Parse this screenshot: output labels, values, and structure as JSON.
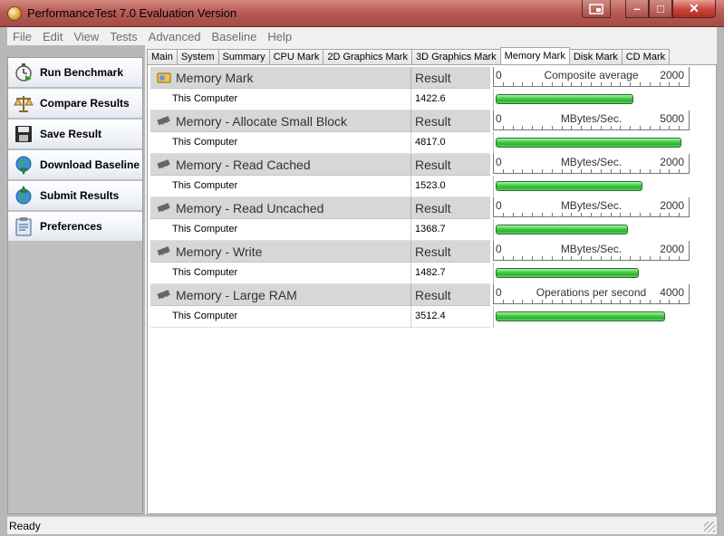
{
  "window": {
    "title": "PerformanceTest 7.0 Evaluation Version"
  },
  "caption_buttons": {
    "minimize": "–",
    "maximize": "□",
    "close": "✕"
  },
  "menu": [
    "File",
    "Edit",
    "View",
    "Tests",
    "Advanced",
    "Baseline",
    "Help"
  ],
  "sidebar": {
    "items": [
      {
        "label": "Run Benchmark",
        "icon": "stopwatch-icon"
      },
      {
        "label": "Compare Results",
        "icon": "scales-icon"
      },
      {
        "label": "Save Result",
        "icon": "floppy-disk-icon"
      },
      {
        "label": "Download Baseline",
        "icon": "globe-download-icon"
      },
      {
        "label": "Submit Results",
        "icon": "globe-upload-icon"
      },
      {
        "label": "Preferences",
        "icon": "clipboard-icon"
      }
    ]
  },
  "tabs": [
    {
      "label": "Main",
      "active": false
    },
    {
      "label": "System",
      "active": false
    },
    {
      "label": "Summary",
      "active": false
    },
    {
      "label": "CPU Mark",
      "active": false
    },
    {
      "label": "2D Graphics Mark",
      "active": false
    },
    {
      "label": "3D Graphics Mark",
      "active": false
    },
    {
      "label": "Memory Mark",
      "active": true
    },
    {
      "label": "Disk Mark",
      "active": false
    },
    {
      "label": "CD Mark",
      "active": false
    }
  ],
  "result_header": "Result",
  "sections": [
    {
      "title": "Memory Mark",
      "row_name": "This Computer",
      "value": "1422.6",
      "scale_min": "0",
      "scale_unit": "Composite average",
      "scale_max": "2000",
      "fraction": 0.7113
    },
    {
      "title": "Memory - Allocate Small Block",
      "row_name": "This Computer",
      "value": "4817.0",
      "scale_min": "0",
      "scale_unit": "MBytes/Sec.",
      "scale_max": "5000",
      "fraction": 0.9634
    },
    {
      "title": "Memory - Read Cached",
      "row_name": "This Computer",
      "value": "1523.0",
      "scale_min": "0",
      "scale_unit": "MBytes/Sec.",
      "scale_max": "2000",
      "fraction": 0.7615
    },
    {
      "title": "Memory - Read Uncached",
      "row_name": "This Computer",
      "value": "1368.7",
      "scale_min": "0",
      "scale_unit": "MBytes/Sec.",
      "scale_max": "2000",
      "fraction": 0.6844
    },
    {
      "title": "Memory - Write",
      "row_name": "This Computer",
      "value": "1482.7",
      "scale_min": "0",
      "scale_unit": "MBytes/Sec.",
      "scale_max": "2000",
      "fraction": 0.7414
    },
    {
      "title": "Memory - Large RAM",
      "row_name": "This Computer",
      "value": "3512.4",
      "scale_min": "0",
      "scale_unit": "Operations per second",
      "scale_max": "4000",
      "fraction": 0.8781
    }
  ],
  "status": {
    "text": "Ready"
  },
  "colors": {
    "bar": "#3cc43c",
    "titlebar": "#b85c55",
    "header": "#d7d7d7"
  }
}
